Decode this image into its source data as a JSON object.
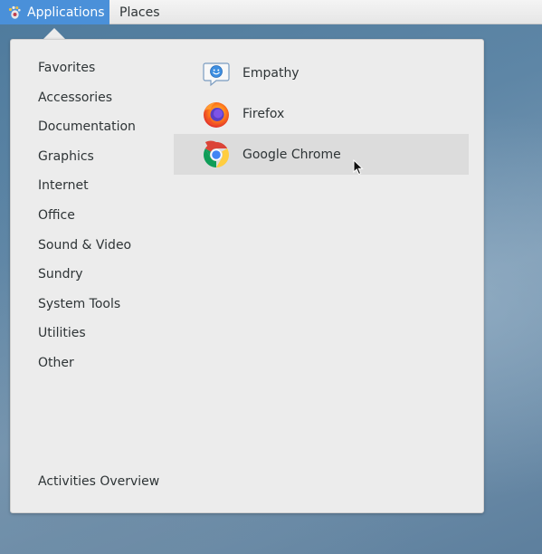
{
  "topbar": {
    "applications_label": "Applications",
    "places_label": "Places",
    "applications_icon": "gnome-foot-icon"
  },
  "categories": [
    {
      "label": "Favorites"
    },
    {
      "label": "Accessories"
    },
    {
      "label": "Documentation"
    },
    {
      "label": "Graphics"
    },
    {
      "label": "Internet"
    },
    {
      "label": "Office"
    },
    {
      "label": "Sound & Video"
    },
    {
      "label": "Sundry"
    },
    {
      "label": "System Tools"
    },
    {
      "label": "Utilities"
    },
    {
      "label": "Other"
    }
  ],
  "activities_overview_label": "Activities Overview",
  "apps": [
    {
      "label": "Empathy",
      "icon": "empathy-icon"
    },
    {
      "label": "Firefox",
      "icon": "firefox-icon"
    },
    {
      "label": "Google Chrome",
      "icon": "chrome-icon",
      "highlighted": true
    }
  ],
  "colors": {
    "accent": "#4a90d9",
    "popup_bg": "#ececec",
    "hover_bg": "#dcdcdc",
    "text": "#2e3436"
  }
}
